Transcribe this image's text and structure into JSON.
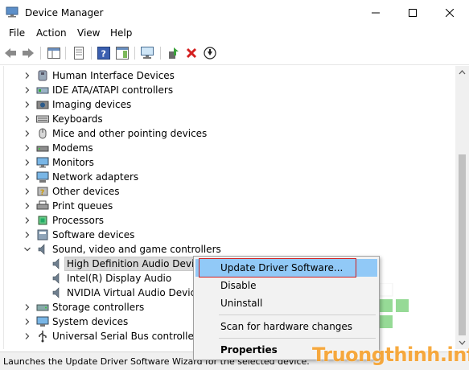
{
  "window": {
    "title": "Device Manager"
  },
  "menu": [
    "File",
    "Action",
    "View",
    "Help"
  ],
  "tree": {
    "items": [
      {
        "label": "Human Interface Devices",
        "icon": "hid-icon",
        "expanded": false
      },
      {
        "label": "IDE ATA/ATAPI controllers",
        "icon": "ide-icon",
        "expanded": false
      },
      {
        "label": "Imaging devices",
        "icon": "camera-icon",
        "expanded": false
      },
      {
        "label": "Keyboards",
        "icon": "keyboard-icon",
        "expanded": false
      },
      {
        "label": "Mice and other pointing devices",
        "icon": "mouse-icon",
        "expanded": false
      },
      {
        "label": "Modems",
        "icon": "modem-icon",
        "expanded": false
      },
      {
        "label": "Monitors",
        "icon": "monitor-icon",
        "expanded": false
      },
      {
        "label": "Network adapters",
        "icon": "network-icon",
        "expanded": false
      },
      {
        "label": "Other devices",
        "icon": "unknown-device-icon",
        "expanded": false
      },
      {
        "label": "Print queues",
        "icon": "printer-icon",
        "expanded": false
      },
      {
        "label": "Processors",
        "icon": "processor-icon",
        "expanded": false
      },
      {
        "label": "Software devices",
        "icon": "software-device-icon",
        "expanded": false
      },
      {
        "label": "Sound, video and game controllers",
        "icon": "speaker-icon",
        "expanded": true
      },
      {
        "label": "High Definition Audio Device",
        "icon": "speaker-icon",
        "child": true,
        "selected": true
      },
      {
        "label": "Intel(R) Display Audio",
        "icon": "speaker-icon",
        "child": true
      },
      {
        "label": "NVIDIA Virtual Audio Device (",
        "icon": "speaker-icon",
        "child": true
      },
      {
        "label": "Storage controllers",
        "icon": "storage-icon",
        "expanded": false
      },
      {
        "label": "System devices",
        "icon": "system-icon",
        "expanded": false
      },
      {
        "label": "Universal Serial Bus controllers",
        "icon": "usb-icon",
        "expanded": false
      }
    ]
  },
  "context_menu": {
    "update": "Update Driver Software...",
    "disable": "Disable",
    "uninstall": "Uninstall",
    "scan": "Scan for hardware changes",
    "properties": "Properties"
  },
  "status": {
    "text": "Launches the Update Driver Software Wizard for the selected device."
  },
  "watermark": {
    "text": "Truongthinh.info"
  },
  "colors": {
    "highlight": "#91c9f7",
    "red_outline": "#d02020",
    "watermark": "#f7a12b",
    "delete_red": "#d42020"
  }
}
